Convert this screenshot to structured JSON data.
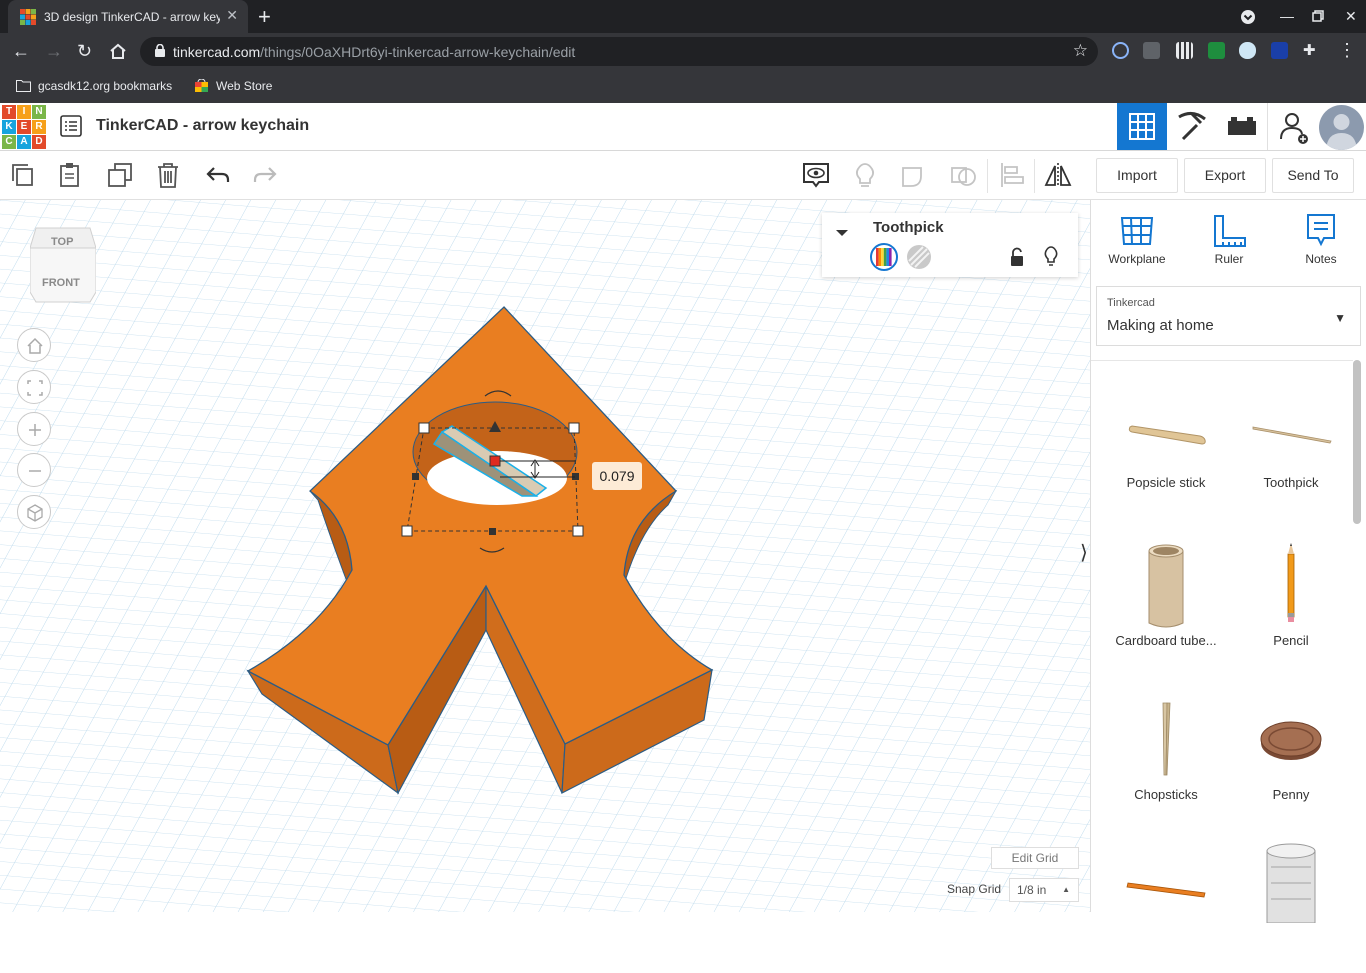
{
  "browser": {
    "tab_title": "3D design TinkerCAD - arrow keychain",
    "url_domain": "tinkercad.com",
    "url_path": "/things/0OaXHDrt6yi-tinkercad-arrow-keychain/edit",
    "bookmarks": [
      "gcasdk12.org bookmarks",
      "Web Store"
    ]
  },
  "app": {
    "logo_letters": [
      "TIN",
      "KER",
      "CAD"
    ],
    "design_title": "TinkerCAD - arrow keychain",
    "toolbar": {
      "import": "Import",
      "export": "Export",
      "send_to": "Send To"
    }
  },
  "viewcube": {
    "top": "TOP",
    "front": "FRONT"
  },
  "inspector": {
    "shape_name": "Toothpick"
  },
  "dimension_value": "0.079",
  "grid": {
    "edit_grid": "Edit Grid",
    "snap_grid_label": "Snap Grid",
    "snap_grid_value": "1/8 in"
  },
  "panel": {
    "tools": [
      "Workplane",
      "Ruler",
      "Notes"
    ],
    "library_category": "Tinkercad",
    "library_name": "Making at home",
    "shapes": [
      "Popsicle stick",
      "Toothpick",
      "Cardboard tube...",
      "Pencil",
      "Chopsticks",
      "Penny"
    ]
  },
  "colors": {
    "accent": "#1477d1",
    "shape_orange": "#e97e21",
    "grid_line": "#b6d4e8",
    "chrome_dark": "#202124"
  }
}
